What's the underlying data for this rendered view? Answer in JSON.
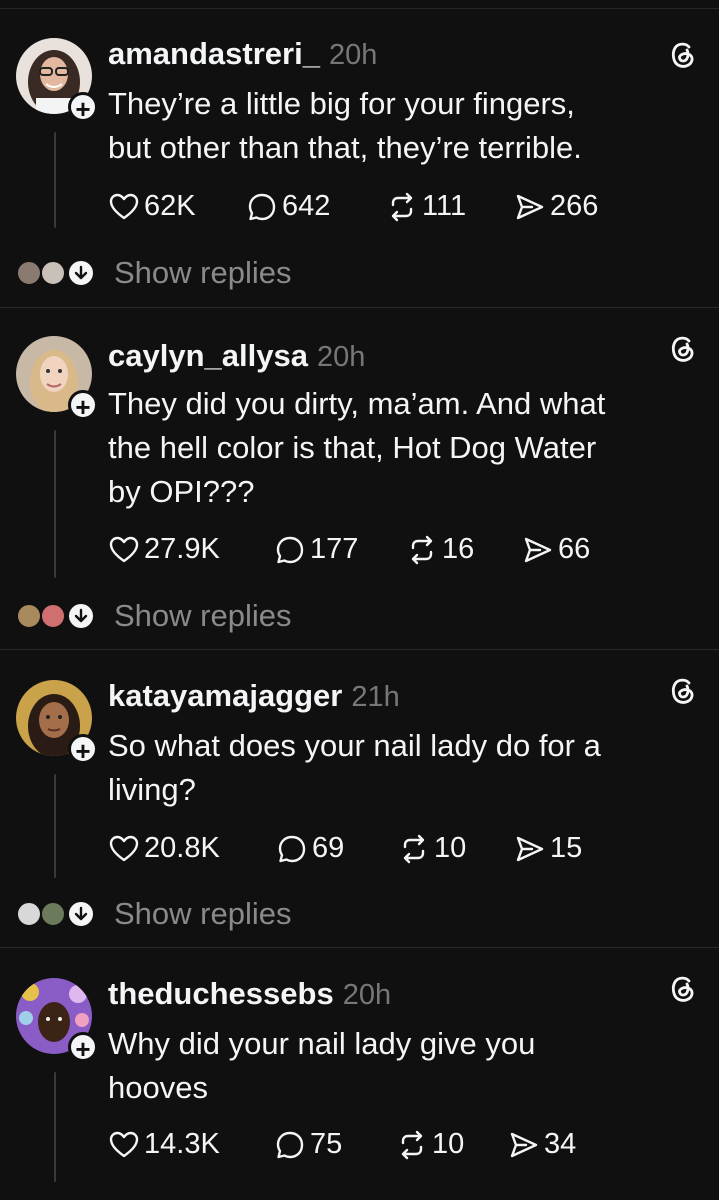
{
  "posts": [
    {
      "username": "amandastreri_",
      "time": "20h",
      "text_lines": [
        "They’re a little big for your fingers,",
        "but other than that, they’re terrible."
      ],
      "likes": "62K",
      "comments": "642",
      "reposts": "111",
      "shares": "266",
      "show_replies": "Show replies",
      "avatar_colors": [
        "#6b5a52",
        "#e8d9cf",
        "#3a2a24"
      ]
    },
    {
      "username": "caylyn_allysa",
      "time": "20h",
      "text_lines": [
        "They did you dirty, ma’am. And what",
        "the hell color is that, Hot Dog Water",
        "by OPI???"
      ],
      "likes": "27.9K",
      "comments": "177",
      "reposts": "16",
      "shares": "66",
      "show_replies": "Show replies",
      "avatar_colors": [
        "#c8b8a6",
        "#f0e6da",
        "#b5926a"
      ]
    },
    {
      "username": "katayamajagger",
      "time": "21h",
      "text_lines": [
        "So what does your nail lady do for a",
        "living?"
      ],
      "likes": "20.8K",
      "comments": "69",
      "reposts": "10",
      "shares": "15",
      "show_replies": "Show replies",
      "avatar_colors": [
        "#c9a24a",
        "#2a1c14",
        "#7a4d30"
      ]
    },
    {
      "username": "theduchessebs",
      "time": "20h",
      "text_lines": [
        "Why did your nail lady give you",
        "hooves"
      ],
      "likes": "14.3K",
      "comments": "75",
      "reposts": "10",
      "shares": "34",
      "avatar_colors": [
        "#8a5cc6",
        "#e0b8f0",
        "#3b2416"
      ]
    }
  ]
}
